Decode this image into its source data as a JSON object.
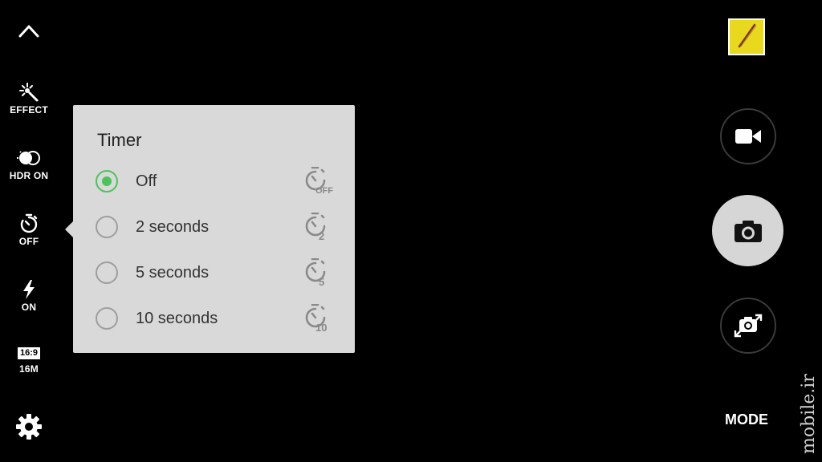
{
  "left_rail": {
    "collapse_icon": "chevron-up-icon",
    "effect": {
      "icon": "effect-wand-icon",
      "label": "EFFECT"
    },
    "hdr": {
      "icon": "hdr-icon",
      "label": "HDR ON"
    },
    "timer": {
      "icon": "timer-icon",
      "label": "OFF"
    },
    "flash": {
      "icon": "flash-icon",
      "label": "ON"
    },
    "ratio": {
      "badge": "16:9",
      "label": "16M"
    },
    "settings_icon": "gear-icon"
  },
  "timer_popup": {
    "title": "Timer",
    "options": [
      {
        "label": "Off",
        "icon_text": "OFF",
        "selected": true
      },
      {
        "label": "2 seconds",
        "icon_text": "2",
        "selected": false
      },
      {
        "label": "5 seconds",
        "icon_text": "5",
        "selected": false
      },
      {
        "label": "10 seconds",
        "icon_text": "10",
        "selected": false
      }
    ],
    "accent_color": "#4cc35a"
  },
  "right_panel": {
    "gallery_thumbnail": "gallery-thumbnail",
    "record_icon": "video-camera-icon",
    "shutter_icon": "camera-icon",
    "switch_camera_icon": "switch-camera-icon",
    "mode_label": "MODE"
  },
  "watermark": "mobile.ir"
}
